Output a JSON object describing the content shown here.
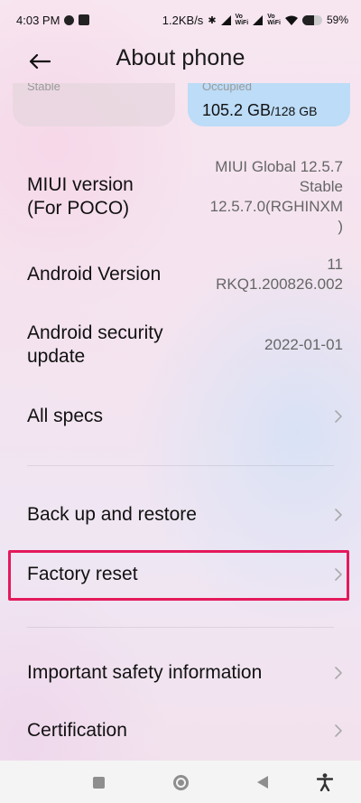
{
  "status_bar": {
    "time": "4:03 PM",
    "speed": "1.2KB/s",
    "volte_top": "Vo",
    "volte_bottom": "WiFi",
    "volte2_top": "Vo",
    "volte2_bottom": "WiFi",
    "battery": "59",
    "battery_level": 0.59
  },
  "header": {
    "title": "About phone"
  },
  "storage": {
    "left_sub": "Stable",
    "right_sub": "Occupied",
    "right_used": "105.2 GB",
    "right_total": "/128 GB"
  },
  "rows": {
    "miui": {
      "label_1": "MIUI version",
      "label_2": "(For POCO)",
      "value_1": "MIUI Global 12.5.7",
      "value_2": "Stable",
      "value_3": "12.5.7.0(RGHINXM",
      "value_4": ")"
    },
    "android": {
      "label": "Android Version",
      "value_1": "11",
      "value_2": "RKQ1.200826.002"
    },
    "security": {
      "label_1": "Android security",
      "label_2": "update",
      "value": "2022-01-01"
    },
    "all_specs": {
      "label": "All specs"
    },
    "backup": {
      "label": "Back up and restore"
    },
    "factory_reset": {
      "label": "Factory reset"
    },
    "safety": {
      "label": "Important safety information"
    },
    "certification": {
      "label": "Certification"
    }
  },
  "colors": {
    "highlight": "#e4195c",
    "storage_card": "#bcdcf7"
  },
  "icons": {
    "back": "arrow-left",
    "chevron": "chevron-right",
    "nav_recents": "square",
    "nav_home": "circle",
    "nav_back": "triangle-left",
    "nav_accessibility": "accessibility-person"
  }
}
